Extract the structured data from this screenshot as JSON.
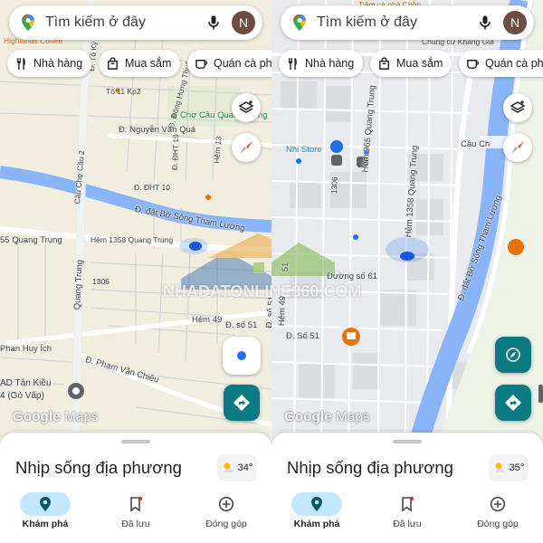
{
  "colors": {
    "accent": "#1a73e8",
    "directions": "#0b7a83",
    "nav_active": "#c2e7ff",
    "water": "#8ab4f8",
    "map_left": "#f1eedf",
    "map_right": "#e8eaed"
  },
  "icons": [
    "google-maps-pin-icon",
    "microphone-icon",
    "restaurant-icon",
    "shopping-bag-icon",
    "coffee-icon",
    "layers-icon",
    "compass-icon",
    "directions-icon",
    "my-location-icon",
    "explore-pin-icon",
    "bookmark-icon",
    "add-circle-icon",
    "weather-icon"
  ],
  "screens": [
    {
      "search": {
        "placeholder": "Tìm kiếm ở đây",
        "avatar": "N"
      },
      "chips": [
        {
          "label": "Nhà hàng",
          "icon": "restaurant-icon"
        },
        {
          "label": "Mua sắm",
          "icon": "shopping-bag-icon"
        },
        {
          "label": "Quán cà phê",
          "icon": "coffee-icon"
        }
      ],
      "map_labels": {
        "highlands": "Highlands Coffee",
        "to_ky": "Đ. Tô Ký",
        "kp2": "Tô 11 Kp2",
        "dong_hung_thuan": "Đ. Đông Hưng Thuận",
        "cho_cau": "Chợ Cầu Quang Trung",
        "nguyen_van_qua": "Đ. Nguyễn Văn Quá",
        "dht19": "Đ. ĐHT 19",
        "dht10": "Đ. ĐHT 10",
        "hem13": "Hẻm 13",
        "cau_cho_cau2": "Cầu Chợ Cầu 2",
        "bo_song": "Đ. đất Bờ Sông Tham Lương",
        "quang_trung_55": "55 Quang Trung",
        "hem1358": "Hẻm 1358 Quang Trung",
        "quang_trung": "Quang Trung",
        "n1306": "1306",
        "hem49": "Hẻm 49",
        "d51_h": "Đ. số 51",
        "d51_v": "Đ. số 51",
        "phan_huy_ich": "Phan Huy Ích",
        "pham_van_chieu": "Đ. Phạm Văn Chiêu",
        "tan_kieu": "AD Tân Kiều",
        "go_vap": "4 (Gò Vấp)"
      },
      "watermark": "NHADATONLINE360.COM",
      "brand": {
        "google": "Google",
        "maps": "Maps"
      },
      "sheet": {
        "title": "Nhịp sống địa phương",
        "temperature": "34°"
      },
      "nav": [
        {
          "label": "Khám phá",
          "active": true
        },
        {
          "label": "Đã lưu",
          "active": false
        },
        {
          "label": "Đóng góp",
          "active": false
        }
      ]
    },
    {
      "search": {
        "placeholder": "Tìm kiếm ở đây",
        "avatar": "N"
      },
      "chips": [
        {
          "label": "Nhà hàng",
          "icon": "restaurant-icon"
        },
        {
          "label": "Mua sắm",
          "icon": "shopping-bag-icon"
        },
        {
          "label": "Quán cà phê",
          "icon": "coffee-icon"
        }
      ],
      "map_labels": {
        "tiem_ca_phe": "Tiệm cà phê Chồn",
        "chung_cu": "Chung cư Khang Gia",
        "hem965": "Hẻm 965 Quang Trung",
        "nhi_store": "Nhi Store",
        "cau_ch": "Cầu Ch",
        "n1306": "1306",
        "hem1358": "Hẻm 1358 Quang Trung",
        "bo_song": "Đ. đất Bờ Sông Tham Lương",
        "duong_so_61": "Đường số 61",
        "hem49": "Hẻm 49",
        "d51": "Đ. Số 51",
        "n51": "51"
      },
      "watermark": "NHADATONLINE360.COM",
      "brand": {
        "google": "Google",
        "maps": "Maps"
      },
      "sheet": {
        "title": "Nhịp sống địa phương",
        "temperature": "35°"
      },
      "nav": [
        {
          "label": "Khám phá",
          "active": true
        },
        {
          "label": "Đã lưu",
          "active": false
        },
        {
          "label": "Đóng góp",
          "active": false
        }
      ]
    }
  ]
}
